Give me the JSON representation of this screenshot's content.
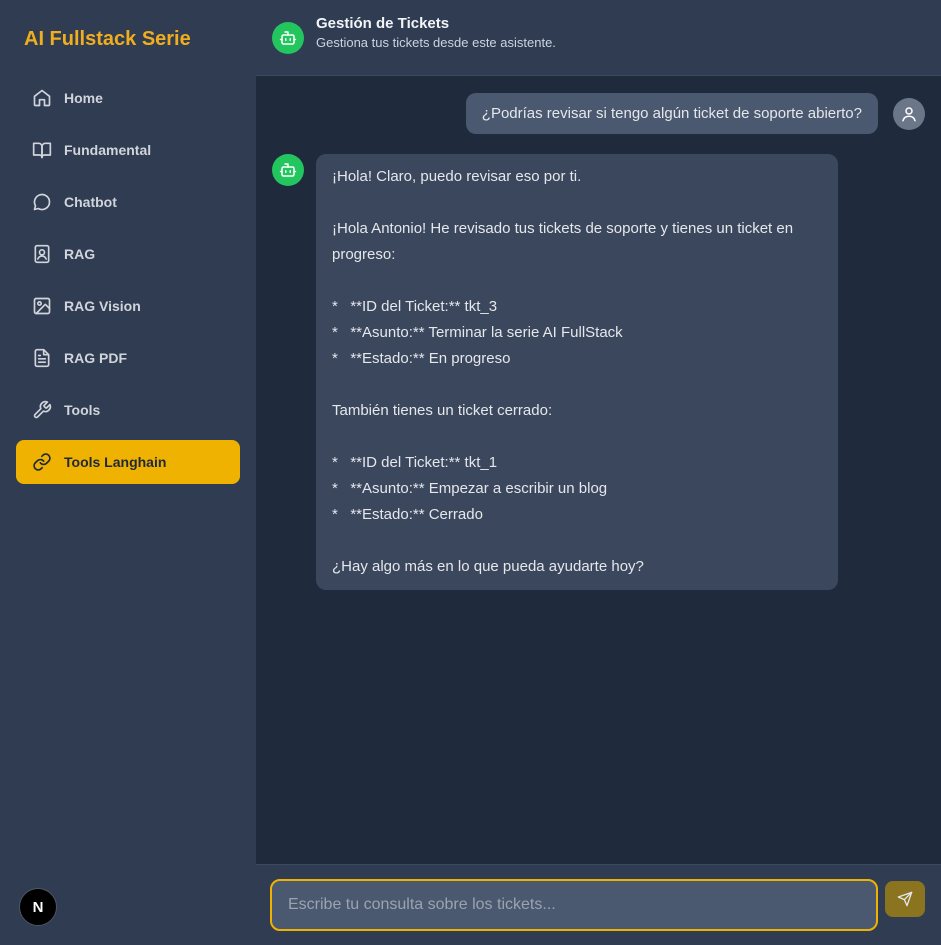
{
  "sidebar": {
    "brand": "AI Fullstack Serie",
    "items": [
      {
        "label": "Home",
        "icon": "home-icon"
      },
      {
        "label": "Fundamental",
        "icon": "book-icon"
      },
      {
        "label": "Chatbot",
        "icon": "chat-bubble-icon"
      },
      {
        "label": "RAG",
        "icon": "contact-book-icon"
      },
      {
        "label": "RAG Vision",
        "icon": "image-icon"
      },
      {
        "label": "RAG PDF",
        "icon": "document-icon"
      },
      {
        "label": "Tools",
        "icon": "wrench-icon"
      },
      {
        "label": "Tools Langhain",
        "icon": "link-icon",
        "active": true
      }
    ],
    "badge": "N"
  },
  "header": {
    "title": "Gestión de Tickets",
    "subtitle": "Gestiona tus tickets desde este asistente."
  },
  "messages": {
    "user": "¿Podrías revisar si tengo algún ticket de soporte abierto?",
    "bot": "¡Hola! Claro, puedo revisar eso por ti.\n\n¡Hola Antonio! He revisado tus tickets de soporte y tienes un ticket en progreso:\n\n*   **ID del Ticket:** tkt_3\n*   **Asunto:** Terminar la serie AI FullStack\n*   **Estado:** En progreso\n\nTambién tienes un ticket cerrado:\n\n*   **ID del Ticket:** tkt_1\n*   **Asunto:** Empezar a escribir un blog\n*   **Estado:** Cerrado\n\n¿Hay algo más en lo que pueda ayudarte hoy?"
  },
  "composer": {
    "placeholder": "Escribe tu consulta sobre los tickets..."
  },
  "colors": {
    "accent": "#f0b200",
    "bot": "#22c55e",
    "sidebar_bg": "#2f3c52",
    "main_bg": "#1f2a3c"
  }
}
